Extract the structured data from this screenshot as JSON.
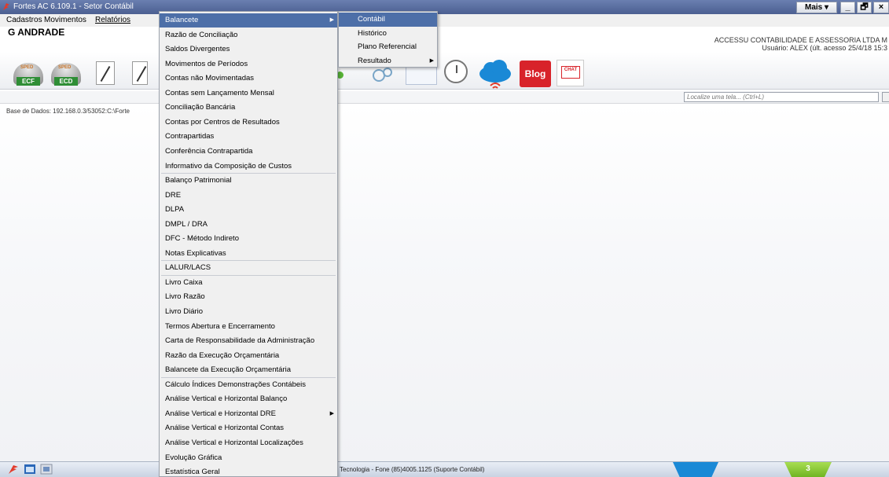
{
  "window": {
    "title": "Fortes AC 6.109.1 - Setor Contábil",
    "mais_label": "Mais ▾",
    "minimize": "_",
    "restore": "🗗",
    "close": "×"
  },
  "menubar": {
    "items": [
      "Cadastros",
      "Movimentos",
      "Relatórios"
    ]
  },
  "header": {
    "company": "G ANDRADE",
    "firm": "ACCESSU CONTABILIDADE E ASSESSORIA LTDA M",
    "user": "Usuário: ALEX  (últ. acesso 25/4/18 15:3"
  },
  "toolbar": {
    "sped_top": "SPED",
    "ecf": "ECF",
    "ecd": "ECD",
    "blog": "Blog",
    "chat": "CHAT"
  },
  "search": {
    "placeholder": "Localize uma tela... (Ctrl+L)"
  },
  "database": "Base de Dados: 192.168.0.3/53052:C:\\Forte",
  "status": {
    "text": "Tecnologia - Fone (85)4005.1125 (Suporte Contábil)",
    "badge": "3"
  },
  "menu": {
    "items": [
      {
        "label": "Balancete",
        "submenu": true
      },
      {
        "label": "Razão de Conciliação"
      },
      {
        "label": "Saldos Divergentes"
      },
      {
        "label": "Movimentos de Períodos"
      },
      {
        "label": "Contas não Movimentadas"
      },
      {
        "label": "Contas sem Lançamento Mensal"
      },
      {
        "label": "Conciliação Bancária"
      },
      {
        "label": "Contas por Centros de Resultados"
      },
      {
        "label": "Contrapartidas"
      },
      {
        "label": "Conferência Contrapartida"
      },
      {
        "label": "Informativo da Composição de Custos"
      },
      {
        "label": "Balanço Patrimonial"
      },
      {
        "label": "DRE"
      },
      {
        "label": "DLPA"
      },
      {
        "label": "DMPL / DRA"
      },
      {
        "label": "DFC - Método Indireto"
      },
      {
        "label": "Notas Explicativas"
      },
      {
        "label": "LALUR/LACS"
      },
      {
        "label": "Livro Caixa"
      },
      {
        "label": "Livro Razão"
      },
      {
        "label": "Livro Diário"
      },
      {
        "label": "Termos Abertura e Encerramento"
      },
      {
        "label": "Carta de Responsabilidade da Administração"
      },
      {
        "label": "Razão da Execução Orçamentária"
      },
      {
        "label": "Balancete da Execução Orçamentária"
      },
      {
        "label": "Cálculo Índices Demonstrações Contábeis"
      },
      {
        "label": "Análise Vertical e Horizontal Balanço"
      },
      {
        "label": "Análise Vertical e Horizontal DRE",
        "submenu": true
      },
      {
        "label": "Análise Vertical e Horizontal Contas"
      },
      {
        "label": "Análise Vertical e Horizontal Localizações"
      },
      {
        "label": "Evolução Gráfica"
      },
      {
        "label": "Estatística Geral"
      }
    ]
  },
  "submenu": {
    "items": [
      {
        "label": "Contábil"
      },
      {
        "label": "Histórico"
      },
      {
        "label": "Plano Referencial"
      },
      {
        "label": "Resultado",
        "submenu": true
      }
    ]
  },
  "colors": {
    "highlight": "#4d6fa8",
    "titlebar": "#5a6ea1"
  }
}
